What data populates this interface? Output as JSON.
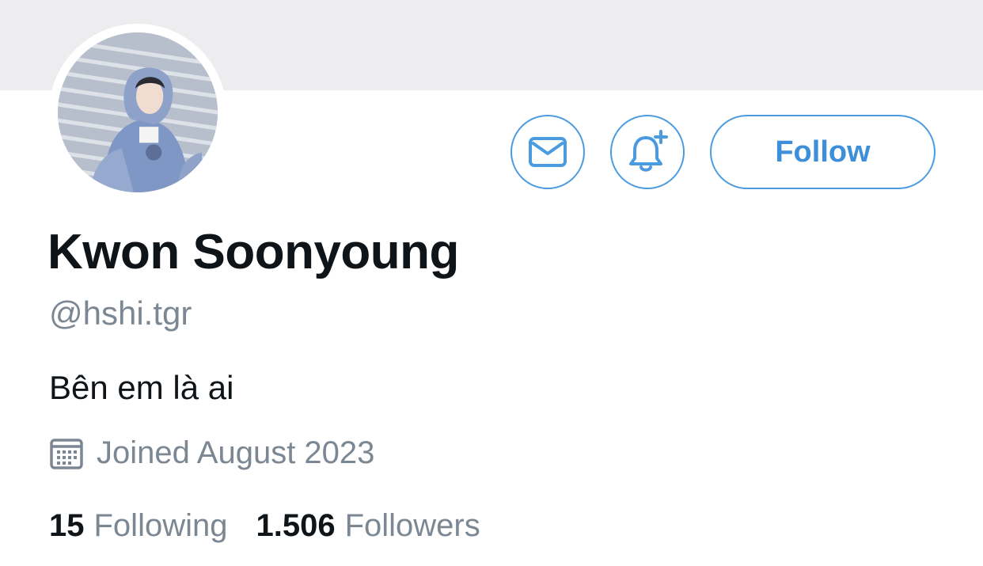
{
  "profile": {
    "display_name": "Kwon Soonyoung",
    "handle": "@hshi.tgr",
    "bio": "Bên em là ai",
    "joined": "Joined August 2023",
    "following_count": "15",
    "following_label": "Following",
    "followers_count": "1.506",
    "followers_label": "Followers"
  },
  "actions": {
    "follow_label": "Follow"
  },
  "icons": {
    "message": "mail-icon",
    "notify": "bell-plus-icon",
    "joined": "calendar-icon"
  },
  "colors": {
    "accent": "#4a9be0",
    "banner": "#ededf0",
    "muted_text": "#7b8793",
    "text": "#0f1419"
  }
}
